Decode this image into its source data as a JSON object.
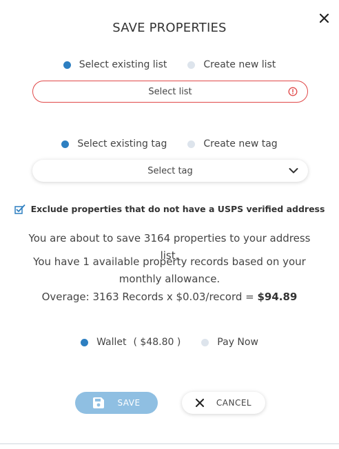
{
  "dialog": {
    "title": "SAVE PROPERTIES"
  },
  "list_section": {
    "option_existing": "Select existing list",
    "option_new": "Create new list",
    "select_placeholder": "Select list"
  },
  "tag_section": {
    "option_existing": "Select existing tag",
    "option_new": "Create new tag",
    "select_placeholder": "Select tag"
  },
  "exclude_checkbox": {
    "label": "Exclude properties that do not have a USPS verified address",
    "checked": true
  },
  "messages": {
    "line1": "You are about to save 3164 properties to your address list.",
    "line2": "You have 1 available property records based on your monthly allowance.",
    "overage_prefix": "Overage: 3163 Records x $0.03/record = ",
    "overage_total": "$94.89"
  },
  "payment": {
    "wallet_label": "Wallet",
    "wallet_balance": "( $48.80 )",
    "pay_now_label": "Pay Now"
  },
  "buttons": {
    "save": "SAVE",
    "cancel": "CANCEL"
  },
  "colors": {
    "accent": "#2d7fc1",
    "error": "#e04848",
    "save_button": "#8fbfe2"
  }
}
